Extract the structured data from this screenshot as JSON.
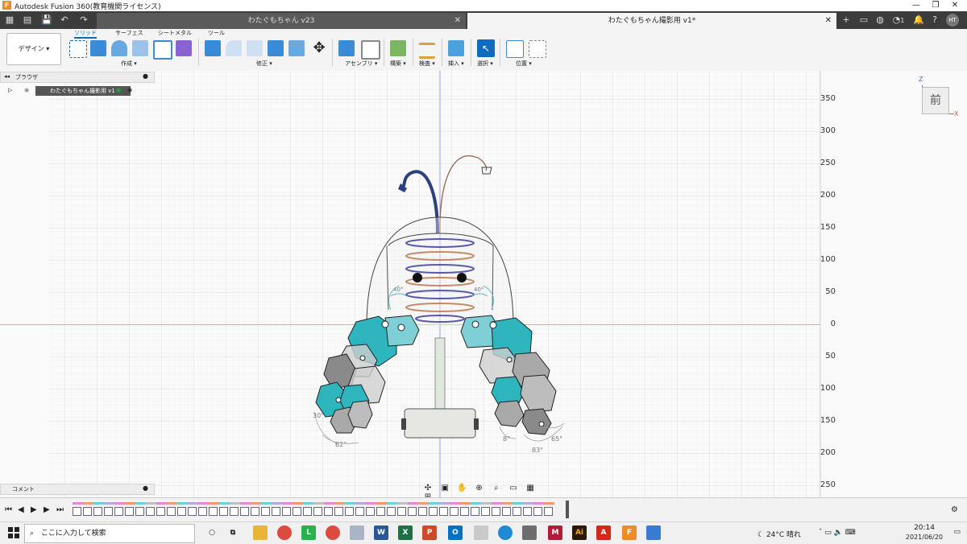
{
  "window": {
    "title": "Autodesk Fusion 360(教育機関ライセンス)",
    "minimize": "—",
    "maximize": "❐",
    "close": "✕"
  },
  "tabs": [
    {
      "label": "わたぐもちゃん v23",
      "active": false
    },
    {
      "label": "わたぐもちゃん撮影用 v1*",
      "active": true
    }
  ],
  "tabbar_right": {
    "new_tab": "+",
    "job_count": "1",
    "user_initials": "HT"
  },
  "toolbar": {
    "workspace": "デザイン ▾",
    "tabs": [
      "ソリッド",
      "サーフェス",
      "シートメタル",
      "ツール"
    ],
    "groups": [
      "作成 ▾",
      "修正 ▾",
      "アセンブリ ▾",
      "構築 ▾",
      "検査 ▾",
      "挿入 ▾",
      "選択 ▾",
      "位置 ▾"
    ]
  },
  "browser": {
    "title": "ブラウザ",
    "root_label": "わたぐもちゃん撮影用 v1"
  },
  "comments": {
    "title": "コメント"
  },
  "viewcube": {
    "face": "前",
    "z_axis": "Z",
    "x_axis": "X"
  },
  "ruler": {
    "ticks": [
      "350",
      "300",
      "250",
      "200",
      "150",
      "100",
      "50",
      "0",
      "50",
      "100",
      "150",
      "200",
      "250"
    ]
  },
  "dimensions": {
    "left_bottom": "62°",
    "left_side": "30°",
    "right_a": "8°",
    "right_b": "83°",
    "right_c": "65°",
    "top_left": "40°",
    "top_right": "40°"
  },
  "colors": {
    "accent": "#0f6cbd",
    "teal": "#2fb5bd",
    "dark_teal": "#1a8c93",
    "grey_part": "#a9a9a9",
    "tabbar": "#3c3c3c"
  },
  "taskbar": {
    "search_placeholder": "ここに入力して検索",
    "weather": "24°C 晴れ",
    "time": "20:14",
    "date": "2021/06/20",
    "apps": [
      "file-explorer",
      "chrome",
      "line",
      "chrome-2",
      "photos",
      "word",
      "excel",
      "powerpoint",
      "outlook",
      "paint",
      "edge",
      "calculator",
      "media",
      "illustrator",
      "acrobat",
      "fusion360",
      "photos-2"
    ]
  }
}
